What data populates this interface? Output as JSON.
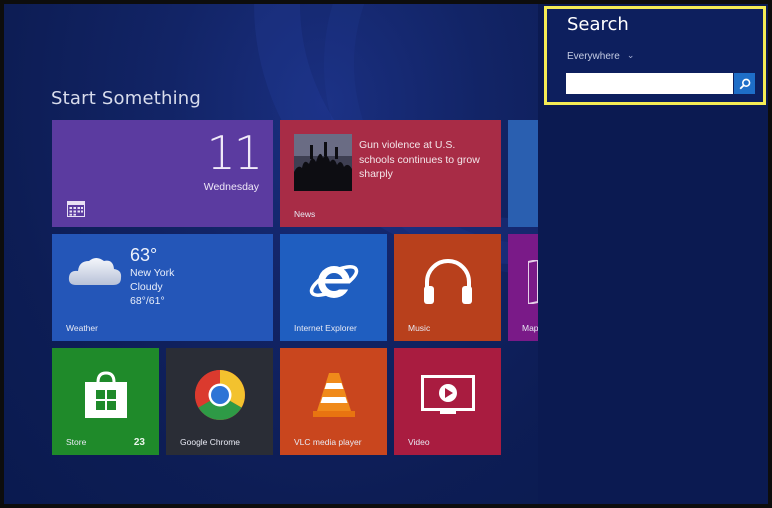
{
  "start": {
    "title": "Start Something"
  },
  "tiles": {
    "calendar": {
      "day": "11",
      "weekday": "Wednesday",
      "icon": "calendar-icon"
    },
    "news": {
      "headline": "Gun violence at U.S. schools continues to grow sharply",
      "label": "News"
    },
    "weather": {
      "temp": "63°",
      "city": "New York",
      "condition": "Cloudy",
      "range": "68°/61°",
      "label": "Weather"
    },
    "ie": {
      "label": "Internet Explorer"
    },
    "music": {
      "label": "Music"
    },
    "maps": {
      "label": "Map"
    },
    "store": {
      "label": "Store",
      "badge": "23"
    },
    "chrome": {
      "label": "Google Chrome"
    },
    "vlc": {
      "label": "VLC media player"
    },
    "video": {
      "label": "Video"
    }
  },
  "search": {
    "title": "Search",
    "scope": "Everywhere",
    "query": "",
    "placeholder": ""
  },
  "colors": {
    "highlight_border": "#f5ec55",
    "background": "#0a1a4f",
    "search_button": "#1e6ec8"
  }
}
